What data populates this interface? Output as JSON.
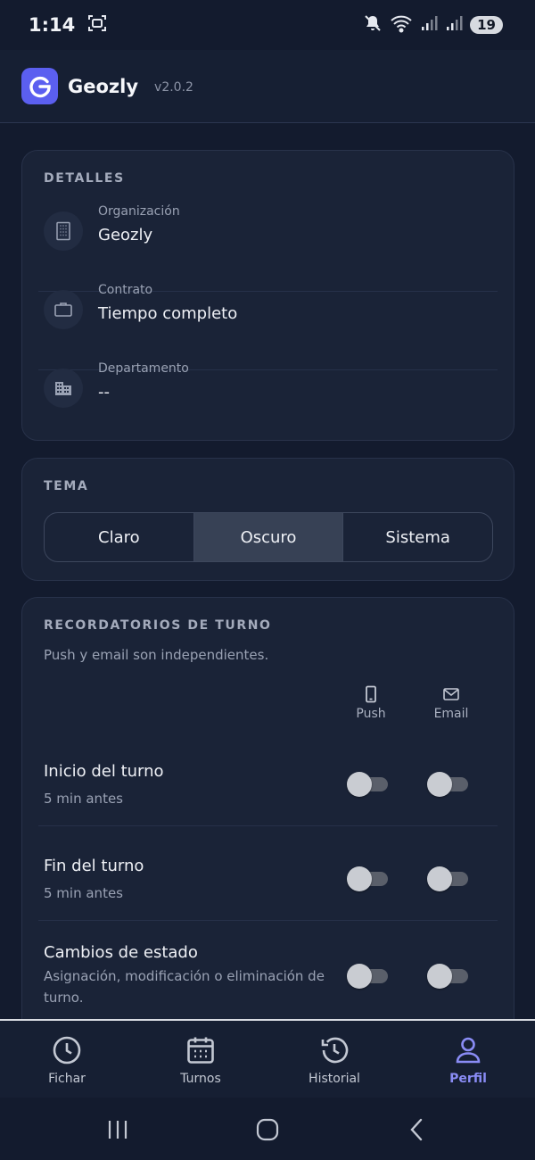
{
  "status_bar": {
    "time": "1:14",
    "battery": "19"
  },
  "header": {
    "app_name": "Geozly",
    "version": "v2.0.2"
  },
  "details": {
    "title": "DETALLES",
    "items": [
      {
        "label": "Organización",
        "value": "Geozly",
        "icon": "building-icon"
      },
      {
        "label": "Contrato",
        "value": "Tiempo completo",
        "icon": "briefcase-icon"
      },
      {
        "label": "Departamento",
        "value": "--",
        "icon": "office-building-icon"
      }
    ]
  },
  "theme": {
    "title": "TEMA",
    "options": [
      "Claro",
      "Oscuro",
      "Sistema"
    ],
    "selected": "Oscuro"
  },
  "reminders": {
    "title": "RECORDATORIOS DE TURNO",
    "subtitle": "Push y email son independientes.",
    "columns": {
      "push": "Push",
      "email": "Email"
    },
    "rows": [
      {
        "title": "Inicio del turno",
        "subtitle": "5 min antes",
        "push": false,
        "email": false
      },
      {
        "title": "Fin del turno",
        "subtitle": "5 min antes",
        "push": false,
        "email": false
      },
      {
        "title": "Cambios de estado",
        "subtitle": "Asignación, modificación o eliminación de turno.",
        "push": false,
        "email": false
      }
    ]
  },
  "bottom_nav": {
    "items": [
      {
        "label": "Fichar",
        "icon": "clock-icon"
      },
      {
        "label": "Turnos",
        "icon": "calendar-icon"
      },
      {
        "label": "Historial",
        "icon": "history-icon"
      },
      {
        "label": "Perfil",
        "icon": "user-icon"
      }
    ],
    "active": "Perfil"
  },
  "colors": {
    "background": "#131b2e",
    "card": "#1a2337",
    "accent": "#5b5ff0",
    "active_nav": "#8a8cf5"
  }
}
